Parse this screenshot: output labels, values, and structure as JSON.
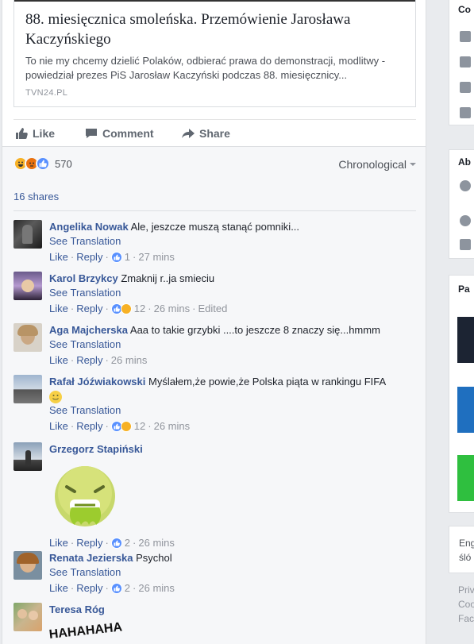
{
  "link_preview": {
    "title": "88. miesięcznica smoleńska. Przemówienie Jarosława Kaczyńskiego",
    "description": "To nie my chcemy dzielić Polaków, odbierać prawa do demonstracji, modlitwy - powiedział prezes PiS Jarosław Kaczyński podczas 88. miesięcznicy...",
    "domain": "TVN24.PL"
  },
  "actions": {
    "like": "Like",
    "comment": "Comment",
    "share": "Share"
  },
  "reactions": {
    "count": "570",
    "icons": [
      "haha-icon",
      "angry-icon",
      "like-icon"
    ]
  },
  "sort": {
    "label": "Chronological"
  },
  "shares": "16 shares",
  "comments": [
    {
      "author": "Angelika Nowak",
      "text": "Ale, jeszcze muszą stanąć pomniki...",
      "see_translation": "See Translation",
      "like": "Like",
      "reply": "Reply",
      "reaction_count": "1",
      "time": "27 mins",
      "edited": ""
    },
    {
      "author": "Karol Brzykcy",
      "text": "Zmaknij r..ja smieciu",
      "see_translation": "See Translation",
      "like": "Like",
      "reply": "Reply",
      "reaction_count": "12",
      "time": "26 mins",
      "edited": "Edited"
    },
    {
      "author": "Aga Majcherska",
      "text": "Aaa to takie grzybki ....to jeszcze 8 znaczy się...hmmm",
      "see_translation": "See Translation",
      "like": "Like",
      "reply": "Reply",
      "reaction_count": "",
      "time": "26 mins",
      "edited": ""
    },
    {
      "author": "Rafał Jóźwiakowski",
      "text": "Myślałem,że powie,że Polska piąta w rankingu FIFA",
      "see_translation": "See Translation",
      "like": "Like",
      "reply": "Reply",
      "reaction_count": "12",
      "time": "26 mins",
      "edited": ""
    },
    {
      "author": "Grzegorz Stapiński",
      "text": "",
      "see_translation": "",
      "like": "Like",
      "reply": "Reply",
      "reaction_count": "2",
      "time": "26 mins",
      "edited": ""
    },
    {
      "author": "Renata Jezierska",
      "text": "Psychol",
      "see_translation": "See Translation",
      "like": "Like",
      "reply": "Reply",
      "reaction_count": "2",
      "time": "26 mins",
      "edited": ""
    },
    {
      "author": "Teresa Róg",
      "text": "",
      "sticker_text": "HAHAHAHA"
    }
  ],
  "right_column": {
    "card1_label": "Co",
    "card2_label": "Ab",
    "card3_label": "Pa",
    "card4_text_1": "Eng",
    "card4_text_2": "śló",
    "footer_1": "Priv",
    "footer_2": "Coo",
    "footer_3": "Fac"
  },
  "colors": {
    "link": "#385898",
    "like_blue": "#5890ff",
    "haha_yellow": "#f7b125",
    "angry_orange": "#e9710f"
  }
}
